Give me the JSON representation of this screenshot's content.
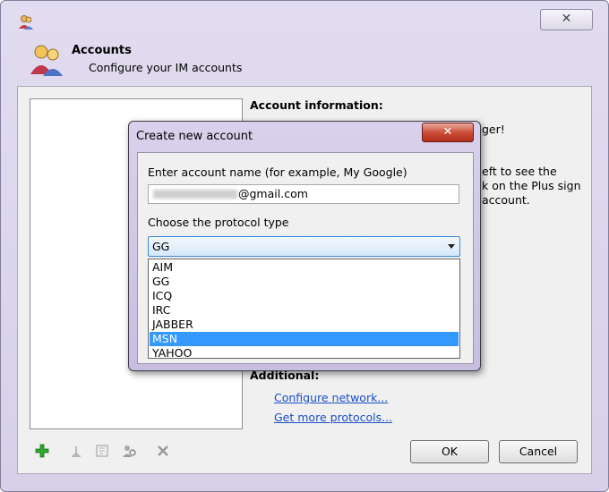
{
  "window": {
    "header_title": "Accounts",
    "header_subtitle": "Configure your IM accounts",
    "close_glyph": "✕"
  },
  "info": {
    "title": "Account information:",
    "frag_line1": "ger!",
    "frag_line2": "eft to see the",
    "frag_line3": "k on the Plus sign",
    "frag_line4": "account."
  },
  "additional": {
    "title": "Additional:",
    "link_network": "Configure network...",
    "link_protocols": "Get more protocols..."
  },
  "toolbar": {
    "icons": [
      "add-icon",
      "rename-icon",
      "edit-icon",
      "account-settings-icon",
      "delete-icon"
    ],
    "add_color": "#2ea82e"
  },
  "buttons": {
    "ok": "OK",
    "cancel": "Cancel"
  },
  "dialog": {
    "title": "Create new account",
    "close_glyph": "✕",
    "name_label": "Enter account name (for example, My Google)",
    "name_value_visible": "@gmail.com",
    "protocol_label": "Choose the protocol type",
    "protocol_selected": "GG",
    "protocol_options": [
      "AIM",
      "GG",
      "ICQ",
      "IRC",
      "JABBER",
      "MSN",
      "YAHOO"
    ],
    "highlighted_option": "MSN",
    "highlight_color": "#3399ff",
    "close_color": "#c84a34"
  }
}
